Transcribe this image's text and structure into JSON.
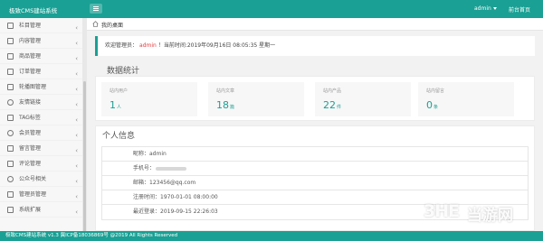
{
  "header": {
    "brand": "极致CMS建站系统",
    "user": "admin",
    "home_link": "前台首页"
  },
  "sidebar": {
    "items": [
      {
        "label": "栏目管理",
        "icon": "grid-icon"
      },
      {
        "label": "内容管理",
        "icon": "document-icon"
      },
      {
        "label": "商品管理",
        "icon": "box-icon"
      },
      {
        "label": "订单管理",
        "icon": "order-icon"
      },
      {
        "label": "轮播图管理",
        "icon": "image-icon"
      },
      {
        "label": "友情链接",
        "icon": "link-icon"
      },
      {
        "label": "TAG标签",
        "icon": "tag-icon"
      },
      {
        "label": "会员管理",
        "icon": "user-icon"
      },
      {
        "label": "留言管理",
        "icon": "message-icon"
      },
      {
        "label": "评论管理",
        "icon": "comment-icon"
      },
      {
        "label": "公众号相关",
        "icon": "wechat-icon"
      },
      {
        "label": "管理员管理",
        "icon": "admin-icon"
      },
      {
        "label": "系统扩展",
        "icon": "extension-icon"
      }
    ]
  },
  "breadcrumb": {
    "label": "我的桌面"
  },
  "welcome": {
    "prefix": "欢迎管理员：",
    "name": "admin",
    "suffix": "！当前时间:2019年09月16日 08:05:35 星期一"
  },
  "stats": {
    "title": "数据统计",
    "cards": [
      {
        "label": "站内用户",
        "value": "1",
        "unit": "人"
      },
      {
        "label": "站内文章",
        "value": "18",
        "unit": "篇"
      },
      {
        "label": "站内产品",
        "value": "22",
        "unit": "件"
      },
      {
        "label": "站内留言",
        "value": "0",
        "unit": "条"
      }
    ]
  },
  "profile": {
    "title": "个人信息",
    "rows": [
      {
        "label": "昵称：admin"
      },
      {
        "label": "手机号："
      },
      {
        "label": "邮箱：123456@qq.com"
      },
      {
        "label": "注册时间：1970-01-01 08:00:00"
      },
      {
        "label": "最近登录：2019-09-15 22:26:03"
      }
    ]
  },
  "footer": {
    "text": "极致CMS建站系统 v1.3 冀ICP备18036869号 @2019 All Rights Reserved"
  },
  "watermark": {
    "logo": "3HE",
    "text": "当游网"
  },
  "colors": {
    "accent": "#1aa094",
    "highlight": "#e4393c"
  }
}
